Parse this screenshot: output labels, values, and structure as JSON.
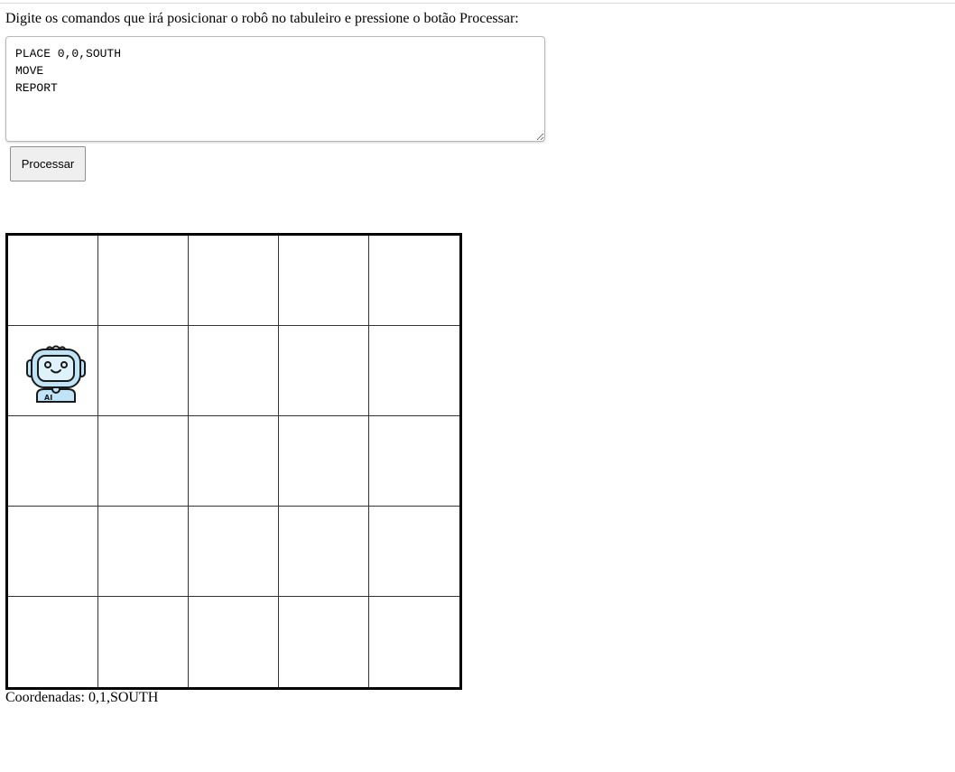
{
  "instructions": "Digite os comandos que irá posicionar o robô no tabuleiro e pressione o botão Processar:",
  "commands_text": "PLACE 0,0,SOUTH\nMOVE\nREPORT",
  "process_button_label": "Processar",
  "board": {
    "columns": 5,
    "rows": 5,
    "robot": {
      "row": 1,
      "col": 0,
      "icon": "robot-icon",
      "badge_text": "AI"
    }
  },
  "coordinates_label": "Coordenadas: 0,1,SOUTH",
  "colors": {
    "robot_face": "#bfe3f7",
    "robot_outline": "#1a1a1a",
    "board_border": "#000000",
    "grid_line": "#333333"
  }
}
